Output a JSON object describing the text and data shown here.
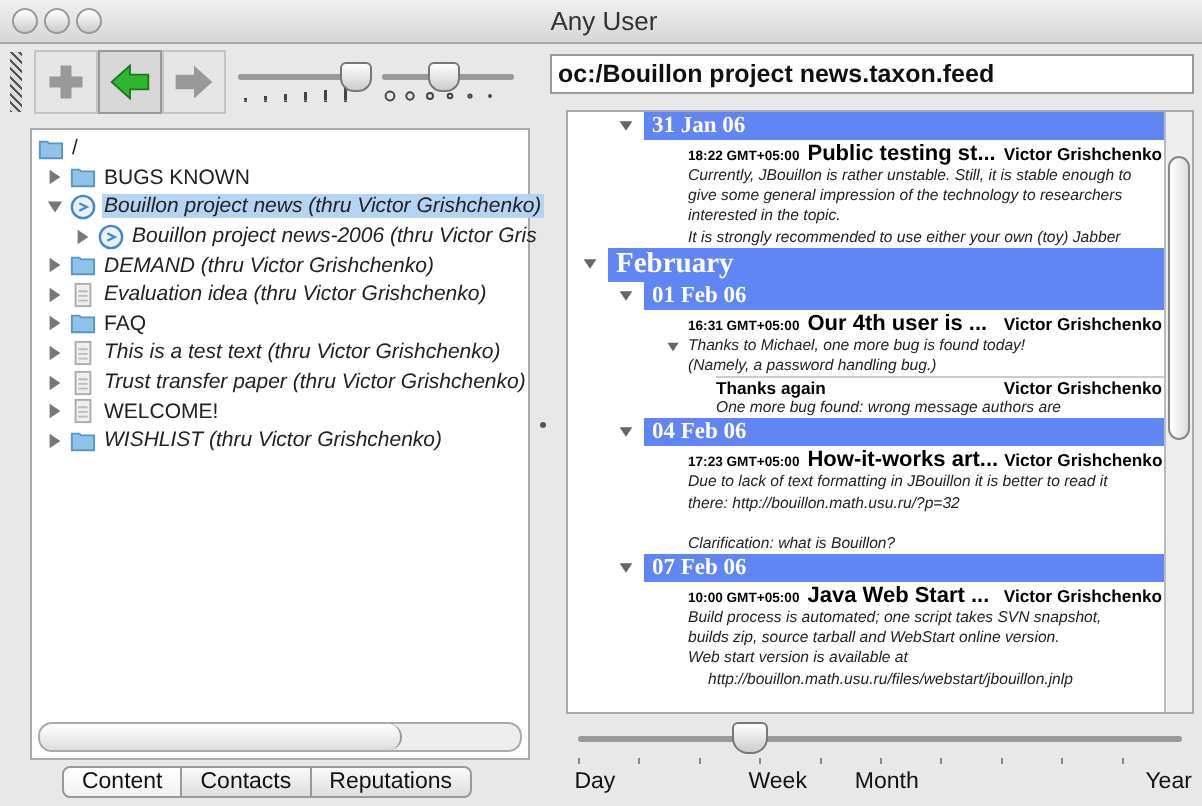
{
  "window": {
    "title": "Any User"
  },
  "toolbar": {
    "buttons": [
      {
        "kind": "add",
        "disabled": true,
        "selected": false
      },
      {
        "kind": "back",
        "disabled": false,
        "selected": true
      },
      {
        "kind": "forward",
        "disabled": true,
        "selected": false
      }
    ],
    "sliders": [
      {
        "kind": "exclaim",
        "level": 0.88
      },
      {
        "kind": "question",
        "level": 0.45
      }
    ]
  },
  "address": {
    "value": "oc:/Bouillon project news.taxon.feed"
  },
  "tree": {
    "label": "/",
    "kind": "folder",
    "children": [
      {
        "label": "BUGS KNOWN",
        "kind": "folder",
        "italic": false,
        "expanded": false,
        "selected": false
      },
      {
        "label": "Bouillon project news (thru Victor Grishchenko)",
        "kind": "feed",
        "italic": true,
        "expanded": true,
        "selected": true,
        "children": [
          {
            "label": "Bouillon project news-2006 (thru Victor Gris",
            "kind": "feed",
            "italic": true,
            "expanded": false,
            "selected": false
          }
        ]
      },
      {
        "label": "DEMAND (thru Victor Grishchenko)",
        "kind": "folder",
        "italic": true,
        "expanded": false,
        "selected": false
      },
      {
        "label": "Evaluation idea (thru Victor Grishchenko)",
        "kind": "doc",
        "italic": true,
        "expanded": false,
        "selected": false
      },
      {
        "label": "FAQ",
        "kind": "folder",
        "italic": false,
        "expanded": false,
        "selected": false
      },
      {
        "label": "This is a test text (thru Victor Grishchenko)",
        "kind": "doc",
        "italic": true,
        "expanded": false,
        "selected": false
      },
      {
        "label": "Trust transfer paper (thru Victor Grishchenko)",
        "kind": "doc",
        "italic": true,
        "expanded": false,
        "selected": false
      },
      {
        "label": "WELCOME!",
        "kind": "doc",
        "italic": false,
        "expanded": false,
        "selected": false
      },
      {
        "label": "WISHLIST (thru Victor Grishchenko)",
        "kind": "folder",
        "italic": true,
        "expanded": false,
        "selected": false
      }
    ]
  },
  "tabs": [
    {
      "label": "Content",
      "selected": true
    },
    {
      "label": "Contacts",
      "selected": false
    },
    {
      "label": "Reputations",
      "selected": false
    }
  ],
  "feed": [
    {
      "kind": "day",
      "label": "31 Jan 06",
      "expanded": true,
      "entries": [
        {
          "time": "18:22 GMT+05:00",
          "title": "Public testing st...",
          "author": "Victor Grishchenko",
          "expanded": false,
          "paragraphs": [
            [
              {
                "text": "Currently, JBouillon is rather unstable. Still, it is stable enough to",
                "indent": false
              },
              {
                "text": "give some general impression of the technology to researchers",
                "indent": false
              },
              {
                "text": "interested in the topic.",
                "indent": false
              },
              {
                "text": "It is strongly recommended to use either your own (toy) Jabber",
                "indent": false
              }
            ]
          ]
        }
      ]
    },
    {
      "kind": "month",
      "label": "February",
      "expanded": true,
      "children": [
        {
          "kind": "day",
          "label": "01 Feb 06",
          "expanded": true,
          "entries": [
            {
              "time": "16:31 GMT+05:00",
              "title": "Our 4th user is ...",
              "author": "Victor Grishchenko",
              "expanded": true,
              "paragraphs": [
                [
                  {
                    "text": "Thanks to Michael, one more bug is found today!",
                    "indent": false
                  },
                  {
                    "text": "(Namely, a password handling bug.)",
                    "indent": false
                  }
                ]
              ],
              "replies": [
                {
                  "title": "Thanks again",
                  "author": "Victor Grishchenko",
                  "text": "One more bug found: wrong message authors are"
                }
              ]
            }
          ]
        },
        {
          "kind": "day",
          "label": "04 Feb 06",
          "expanded": true,
          "entries": [
            {
              "time": "17:23 GMT+05:00",
              "title": "How-it-works art...",
              "author": "Victor Grishchenko",
              "expanded": false,
              "paragraphs": [
                [
                  {
                    "text": "Due to lack of text formatting in JBouillon it is better to read it",
                    "indent": false
                  },
                  {
                    "text": "there: http://bouillon.math.usu.ru/?p=32",
                    "indent": false
                  }
                ],
                [
                  {
                    "text": "Clarification: what is Bouillon?",
                    "indent": false
                  }
                ]
              ]
            }
          ]
        },
        {
          "kind": "day",
          "label": "07 Feb 06",
          "expanded": true,
          "entries": [
            {
              "time": "10:00 GMT+05:00",
              "title": "Java Web Start ...",
              "author": "Victor Grishchenko",
              "expanded": false,
              "paragraphs": [
                [
                  {
                    "text": "Build process is automated; one script takes SVN snapshot,",
                    "indent": false
                  },
                  {
                    "text": "builds zip, source tarball and WebStart online version.",
                    "indent": false
                  },
                  {
                    "text": "Web start version is available at",
                    "indent": false
                  },
                  {
                    "text": "http://bouillon.math.usu.ru/files/webstart/jbouillon.jnlp",
                    "indent": true
                  }
                ]
              ]
            }
          ]
        }
      ]
    }
  ],
  "timeline": {
    "level": 0.28,
    "labels": [
      "Day",
      "Week",
      "Month",
      "Year"
    ]
  }
}
